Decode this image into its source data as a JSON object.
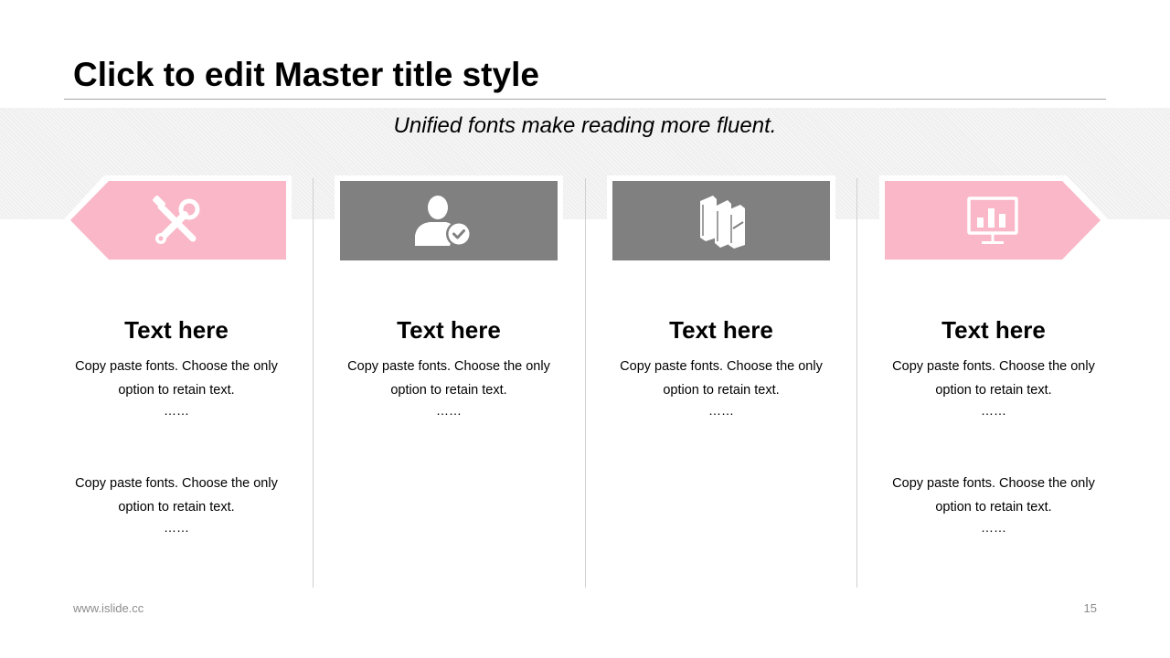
{
  "slide": {
    "title": "Click to edit Master title style",
    "subtitle": "Unified fonts make reading more fluent."
  },
  "colors": {
    "pink": "#f9b7c7",
    "gray": "#808080",
    "band": "#efefef",
    "divider": "#d0d0d0"
  },
  "columns": [
    {
      "icon": "tools-icon",
      "heading": "Text here",
      "para1": "Copy paste fonts. Choose the only option to retain text.",
      "ellipsis1": "……",
      "para2": "Copy paste fonts. Choose the only option to retain text.",
      "ellipsis2": "……"
    },
    {
      "icon": "user-check-icon",
      "heading": "Text here",
      "para1": "Copy paste fonts. Choose the only option to retain text.",
      "ellipsis1": "……"
    },
    {
      "icon": "books-icon",
      "heading": "Text here",
      "para1": "Copy paste fonts. Choose the only option to retain text.",
      "ellipsis1": "……"
    },
    {
      "icon": "presentation-chart-icon",
      "heading": "Text here",
      "para1": "Copy paste fonts. Choose the only option to retain text.",
      "ellipsis1": "……",
      "para2": "Copy paste fonts. Choose the only option to retain text.",
      "ellipsis2": "……"
    }
  ],
  "footer": {
    "url": "www.islide.cc",
    "page_number": "15"
  }
}
